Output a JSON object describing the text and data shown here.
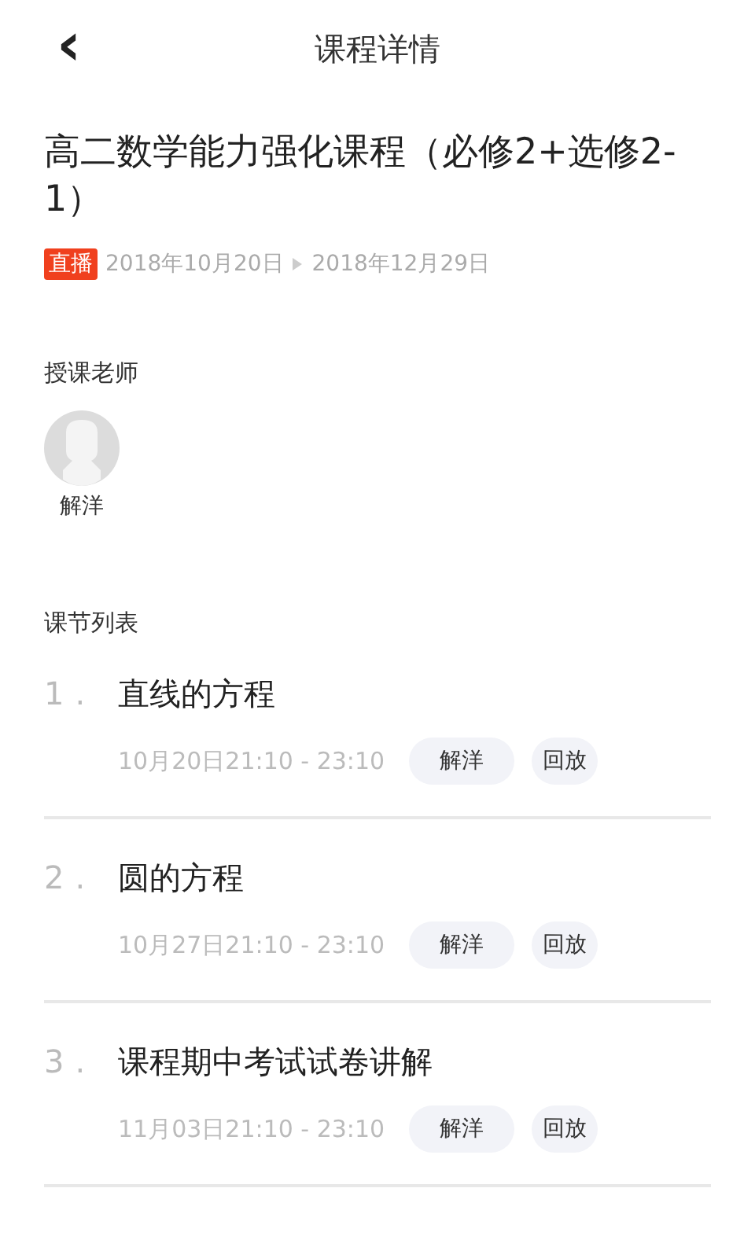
{
  "header": {
    "back": "‹",
    "title": "课程详情"
  },
  "course": {
    "title": "高二数学能力强化课程（必修2+选修2-1）",
    "badge": "直播",
    "start": "2018年10月20日",
    "end": "2018年12月29日"
  },
  "teachers": {
    "heading": "授课老师",
    "items": [
      {
        "name": "解洋"
      }
    ]
  },
  "lessons": {
    "heading": "课节列表",
    "items": [
      {
        "number": "1.",
        "title": "直线的方程",
        "time": "10月20日21:10 - 23:10",
        "teacher": "解洋",
        "action": "回放"
      },
      {
        "number": "2.",
        "title": "圆的方程",
        "time": "10月27日21:10 - 23:10",
        "teacher": "解洋",
        "action": "回放"
      },
      {
        "number": "3.",
        "title": "课程期中考试试卷讲解",
        "time": "11月03日21:10 - 23:10",
        "teacher": "解洋",
        "action": "回放"
      }
    ]
  }
}
